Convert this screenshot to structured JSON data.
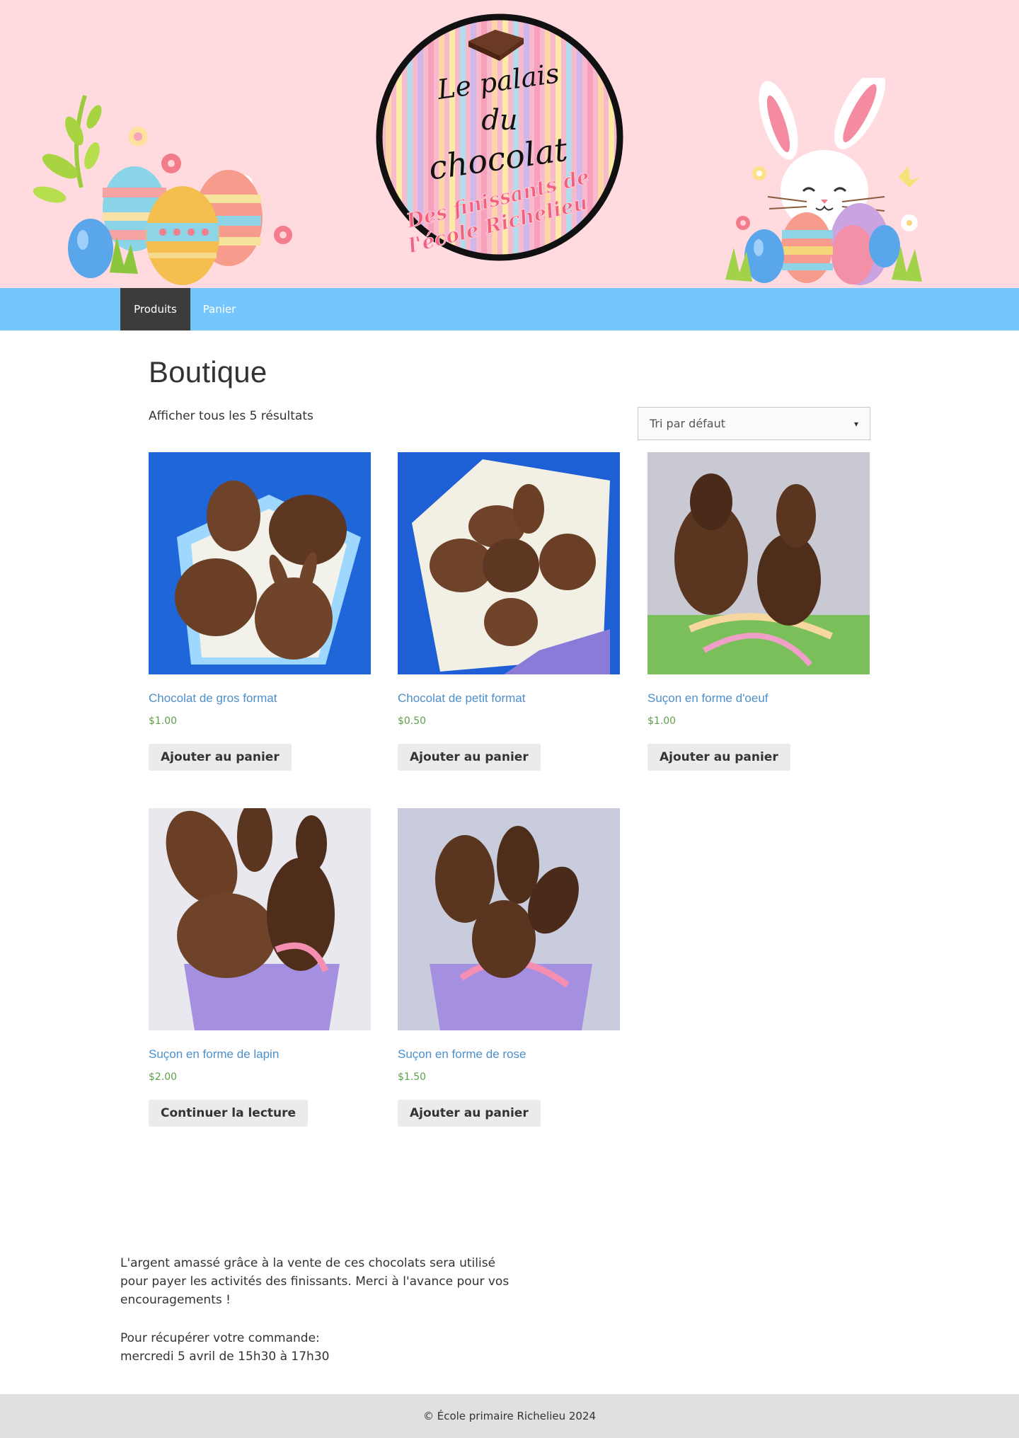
{
  "header": {
    "logo_line1": "Le palais",
    "logo_line2": "du",
    "logo_line3": "chocolat",
    "logo_sub1": "Des finissants de",
    "logo_sub2": "l'école Richelieu"
  },
  "nav": {
    "items": [
      {
        "label": "Produits",
        "active": true
      },
      {
        "label": "Panier",
        "active": false
      }
    ]
  },
  "main": {
    "title": "Boutique",
    "result_count": "Afficher tous les 5 résultats",
    "sort": {
      "selected": "Tri par défaut"
    }
  },
  "products": [
    {
      "name": "Chocolat de gros format",
      "price": "$1.00",
      "button": "Ajouter au panier"
    },
    {
      "name": "Chocolat de petit format",
      "price": "$0.50",
      "button": "Ajouter au panier"
    },
    {
      "name": "Suçon en forme d'oeuf",
      "price": "$1.00",
      "button": "Ajouter au panier"
    },
    {
      "name": "Suçon en forme de lapin",
      "price": "$2.00",
      "button": "Continuer la lecture"
    },
    {
      "name": "Suçon en forme de rose",
      "price": "$1.50",
      "button": "Ajouter au panier"
    }
  ],
  "about": {
    "text": "L'argent amassé grâce à la vente de ces chocolats sera utilisé pour payer les activités des finissants. Merci à l'avance pour vos encouragements !",
    "pickup_line1": "Pour récupérer votre commande:",
    "pickup_line2": "mercredi 5 avril de 15h30 à 17h30"
  },
  "footer": {
    "text": "© École primaire Richelieu 2024"
  }
}
